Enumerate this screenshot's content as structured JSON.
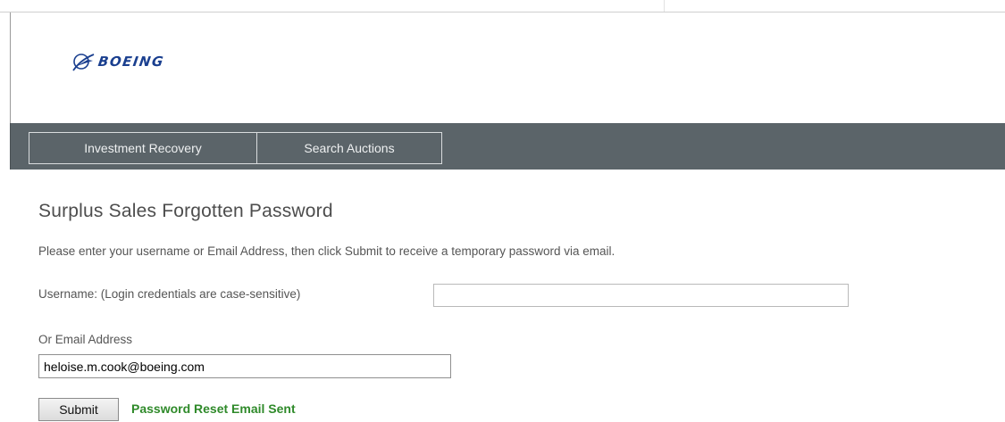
{
  "logo": {
    "brand_text": "BOEING",
    "brand_color": "#1a3f8f",
    "icon": "boeing-logo-icon"
  },
  "nav": {
    "items": [
      {
        "label": "Investment Recovery"
      },
      {
        "label": "Search Auctions"
      }
    ],
    "bar_color": "#5b6469"
  },
  "page": {
    "title": "Surplus Sales Forgotten Password",
    "instructions": "Please enter your username or Email Address, then click Submit to receive a temporary password via email."
  },
  "form": {
    "username_label": "Username: (Login credentials are case-sensitive)",
    "username_value": "",
    "email_label": "Or Email Address",
    "email_value": "heloise.m.cook@boeing.com",
    "submit_label": "Submit"
  },
  "status": {
    "message": "Password Reset Email Sent",
    "color": "#2f8a2a"
  }
}
